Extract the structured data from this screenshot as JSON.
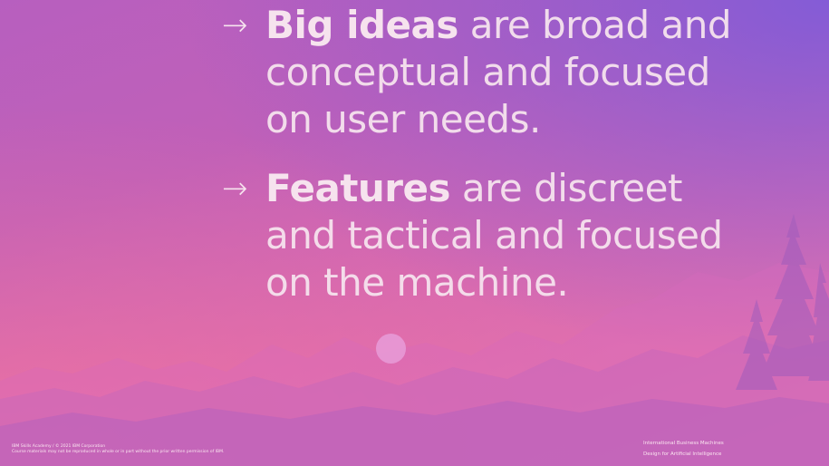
{
  "bullets": [
    {
      "bold": "Big ideas",
      "rest_line1": " are broad and",
      "line2": "conceptual and focused",
      "line3": "on user needs."
    },
    {
      "bold": "Features",
      "rest_line1": " are discreet",
      "line2": "and tactical and focused",
      "line3": "on the machine."
    }
  ],
  "arrow_glyph": "→",
  "footer": {
    "left_line1": "IBM Skills Academy / © 2021 IBM Corporation",
    "left_line2": "Course materials may not be reproduced in whole or in part without the prior written permission of IBM.",
    "right_line1": "International Business Machines",
    "right_line2": "Design for Artificial Intelligence"
  },
  "colors": {
    "text": "#f6e3ee",
    "background_top_right": "#8a5fd8",
    "background_bottom_left": "#f07aa8"
  }
}
